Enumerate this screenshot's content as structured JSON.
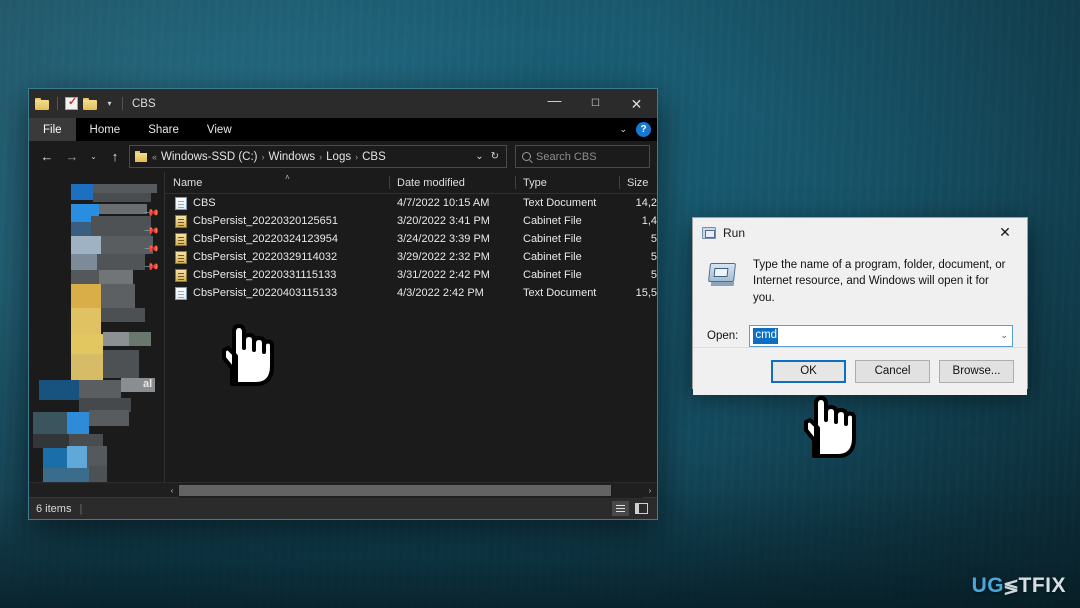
{
  "desktop": {
    "background_color": "#17566b",
    "watermark": {
      "part1": "UG",
      "part2": "≶",
      "part3": "TFIX"
    }
  },
  "explorer": {
    "title": "CBS",
    "quick_access": [
      {
        "name": "folder-icon",
        "label": "Folder"
      },
      {
        "name": "properties-icon",
        "label": "Properties"
      },
      {
        "name": "new-folder-icon",
        "label": "New folder"
      },
      {
        "name": "customize-caret-icon",
        "label": "▾"
      }
    ],
    "window_controls": {
      "minimize": "—",
      "maximize": "☐",
      "close": "✕"
    },
    "ribbon": {
      "tabs": [
        {
          "label": "File",
          "active": true
        },
        {
          "label": "Home",
          "active": false
        },
        {
          "label": "Share",
          "active": false
        },
        {
          "label": "View",
          "active": false
        }
      ],
      "collapse_caret": "⌄",
      "help_label": "?"
    },
    "address_bar": {
      "back": "←",
      "forward": "→",
      "recent": "⌄",
      "up": "↑",
      "root_chevron": "«",
      "crumbs": [
        "Windows-SSD (C:)",
        "Windows",
        "Logs",
        "CBS"
      ],
      "crumb_sep": "›",
      "dropdown": "⌄",
      "refresh": "↻"
    },
    "search": {
      "placeholder": "Search CBS",
      "icon": "search-icon"
    },
    "columns": [
      {
        "key": "name",
        "label": "Name",
        "sorted": true,
        "sort_caret": "˄"
      },
      {
        "key": "date",
        "label": "Date modified"
      },
      {
        "key": "type",
        "label": "Type"
      },
      {
        "key": "size",
        "label": "Size"
      }
    ],
    "files": [
      {
        "name": "CBS",
        "date": "4/7/2022 10:15 AM",
        "type": "Text Document",
        "size": "14,2",
        "icon": "text-document-icon"
      },
      {
        "name": "CbsPersist_20220320125651",
        "date": "3/20/2022 3:41 PM",
        "type": "Cabinet File",
        "size": "1,4",
        "icon": "cabinet-file-icon"
      },
      {
        "name": "CbsPersist_20220324123954",
        "date": "3/24/2022 3:39 PM",
        "type": "Cabinet File",
        "size": "5",
        "icon": "cabinet-file-icon"
      },
      {
        "name": "CbsPersist_20220329114032",
        "date": "3/29/2022 2:32 PM",
        "type": "Cabinet File",
        "size": "5",
        "icon": "cabinet-file-icon"
      },
      {
        "name": "CbsPersist_20220331115133",
        "date": "3/31/2022 2:42 PM",
        "type": "Cabinet File",
        "size": "5",
        "icon": "cabinet-file-icon"
      },
      {
        "name": "CbsPersist_20220403115133",
        "date": "4/3/2022 2:42 PM",
        "type": "Text Document",
        "size": "15,5",
        "icon": "text-document-icon"
      }
    ],
    "nav_pane": {
      "censored": true,
      "visible_fragment": "al",
      "pin_icon": "📌"
    },
    "scrollbar": {
      "left_arrow": "‹",
      "right_arrow": "›"
    },
    "status": {
      "item_count": "6 items",
      "separator": "|",
      "view_details": "details-view-icon",
      "view_tiles": "tiles-view-icon"
    }
  },
  "run_dialog": {
    "title": "Run",
    "close": "✕",
    "description": "Type the name of a program, folder, document, or Internet resource, and Windows will open it for you.",
    "open_label": "Open:",
    "open_value": "cmd",
    "dropdown_caret": "⌄",
    "buttons": [
      {
        "label": "OK",
        "primary": true
      },
      {
        "label": "Cancel",
        "primary": false
      },
      {
        "label": "Browse...",
        "primary": false
      }
    ]
  }
}
